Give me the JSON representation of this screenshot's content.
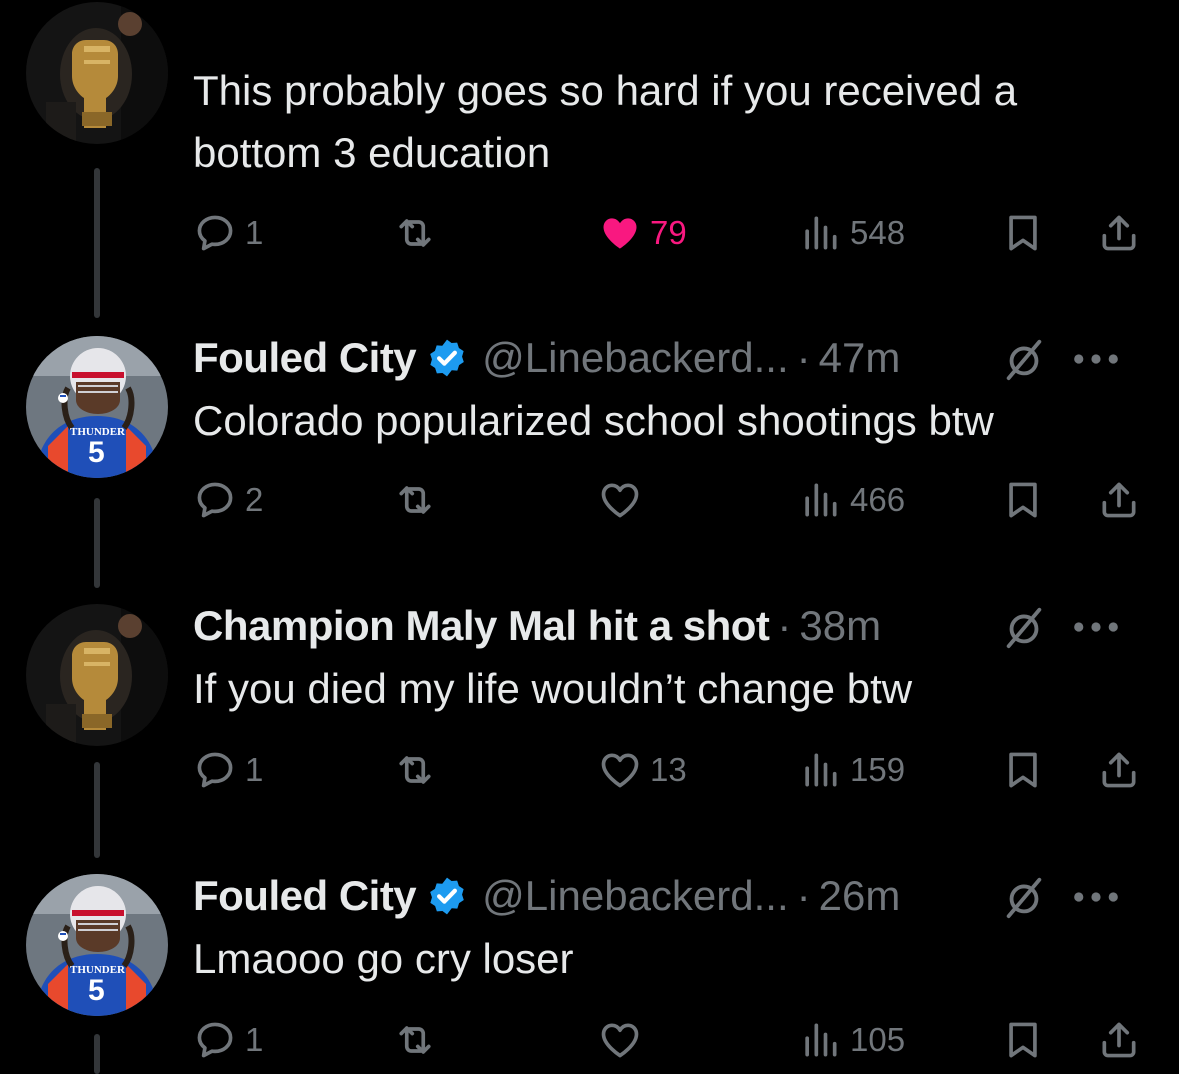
{
  "colors": {
    "background": "#000000",
    "text": "#e7e9ea",
    "secondary": "#71767b",
    "like": "#f91880",
    "verified": "#1d9bf0"
  },
  "tweets": [
    {
      "name": "",
      "handle": "",
      "time": "",
      "verified": false,
      "avatar": "trophy-avatar",
      "text": "This probably goes so hard if you received a bottom 3 education",
      "replies": "1",
      "retweets": "",
      "likes": "79",
      "liked": true,
      "views": "548"
    },
    {
      "name": "Fouled City",
      "handle": "@Linebackerd...",
      "time": "47m",
      "verified": true,
      "avatar": "football-avatar",
      "avatar_text": "THUNDER",
      "avatar_number": "5",
      "text": "Colorado popularized school shootings btw",
      "replies": "2",
      "retweets": "",
      "likes": "",
      "liked": false,
      "views": "466"
    },
    {
      "name": "Champion Maly Mal hit a shot",
      "handle": "",
      "time": "38m",
      "verified": false,
      "avatar": "trophy-avatar",
      "text": "If you died my life wouldn’t change btw",
      "replies": "1",
      "retweets": "",
      "likes": "13",
      "liked": false,
      "views": "159"
    },
    {
      "name": "Fouled City",
      "handle": "@Linebackerd...",
      "time": "26m",
      "verified": true,
      "avatar": "football-avatar",
      "avatar_text": "THUNDER",
      "avatar_number": "5",
      "text": "Lmaooo go cry loser",
      "replies": "1",
      "retweets": "",
      "likes": "",
      "liked": false,
      "views": "105"
    }
  ],
  "icons": {
    "reply": "reply-icon",
    "retweet": "retweet-icon",
    "like": "heart-icon",
    "views": "views-icon",
    "bookmark": "bookmark-icon",
    "share": "share-icon",
    "mute": "mute-icon",
    "more": "more-icon",
    "verified": "verified-badge-icon"
  }
}
